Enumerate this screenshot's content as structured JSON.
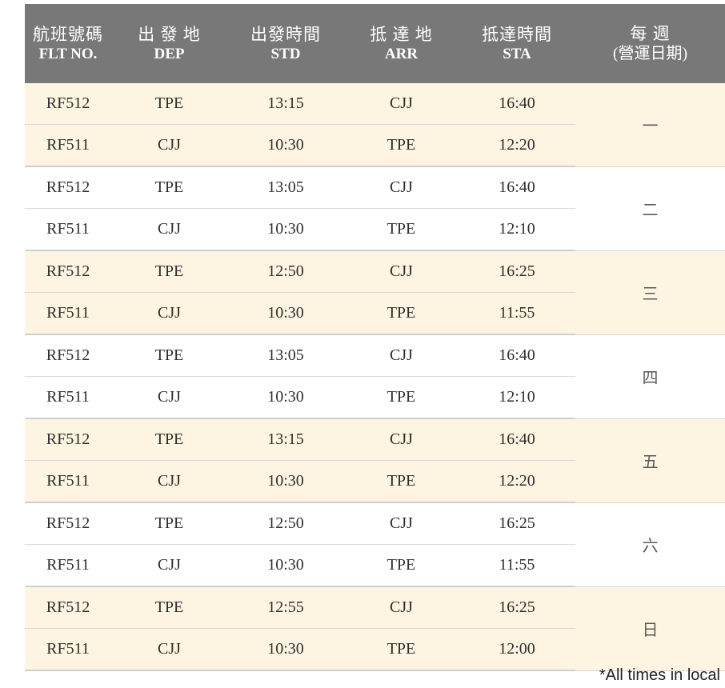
{
  "headers": [
    {
      "zh": "航班號碼",
      "en": "FLT NO."
    },
    {
      "zh": "出 發 地",
      "en": "DEP"
    },
    {
      "zh": "出發時間",
      "en": "STD"
    },
    {
      "zh": "抵 達 地",
      "en": "ARR"
    },
    {
      "zh": "抵達時間",
      "en": "STA"
    },
    {
      "zh": "每 週",
      "en": "(營運日期)"
    }
  ],
  "days": [
    {
      "day": "一",
      "flights": [
        {
          "flt": "RF512",
          "dep": "TPE",
          "std": "13:15",
          "arr": "CJJ",
          "sta": "16:40"
        },
        {
          "flt": "RF511",
          "dep": "CJJ",
          "std": "10:30",
          "arr": "TPE",
          "sta": "12:20"
        }
      ]
    },
    {
      "day": "二",
      "flights": [
        {
          "flt": "RF512",
          "dep": "TPE",
          "std": "13:05",
          "arr": "CJJ",
          "sta": "16:40"
        },
        {
          "flt": "RF511",
          "dep": "CJJ",
          "std": "10:30",
          "arr": "TPE",
          "sta": "12:10"
        }
      ]
    },
    {
      "day": "三",
      "flights": [
        {
          "flt": "RF512",
          "dep": "TPE",
          "std": "12:50",
          "arr": "CJJ",
          "sta": "16:25"
        },
        {
          "flt": "RF511",
          "dep": "CJJ",
          "std": "10:30",
          "arr": "TPE",
          "sta": "11:55"
        }
      ]
    },
    {
      "day": "四",
      "flights": [
        {
          "flt": "RF512",
          "dep": "TPE",
          "std": "13:05",
          "arr": "CJJ",
          "sta": "16:40"
        },
        {
          "flt": "RF511",
          "dep": "CJJ",
          "std": "10:30",
          "arr": "TPE",
          "sta": "12:10"
        }
      ]
    },
    {
      "day": "五",
      "flights": [
        {
          "flt": "RF512",
          "dep": "TPE",
          "std": "13:15",
          "arr": "CJJ",
          "sta": "16:40"
        },
        {
          "flt": "RF511",
          "dep": "CJJ",
          "std": "10:30",
          "arr": "TPE",
          "sta": "12:20"
        }
      ]
    },
    {
      "day": "六",
      "flights": [
        {
          "flt": "RF512",
          "dep": "TPE",
          "std": "12:50",
          "arr": "CJJ",
          "sta": "16:25"
        },
        {
          "flt": "RF511",
          "dep": "CJJ",
          "std": "10:30",
          "arr": "TPE",
          "sta": "11:55"
        }
      ]
    },
    {
      "day": "日",
      "flights": [
        {
          "flt": "RF512",
          "dep": "TPE",
          "std": "12:55",
          "arr": "CJJ",
          "sta": "16:25"
        },
        {
          "flt": "RF511",
          "dep": "CJJ",
          "std": "10:30",
          "arr": "TPE",
          "sta": "12:00"
        }
      ]
    }
  ],
  "footnote": "*All times in local",
  "colors": {
    "header_bg": "#787878",
    "header_text": "#ffffff",
    "shade_row": "#fdf4e1",
    "plain_row": "#ffffff"
  }
}
